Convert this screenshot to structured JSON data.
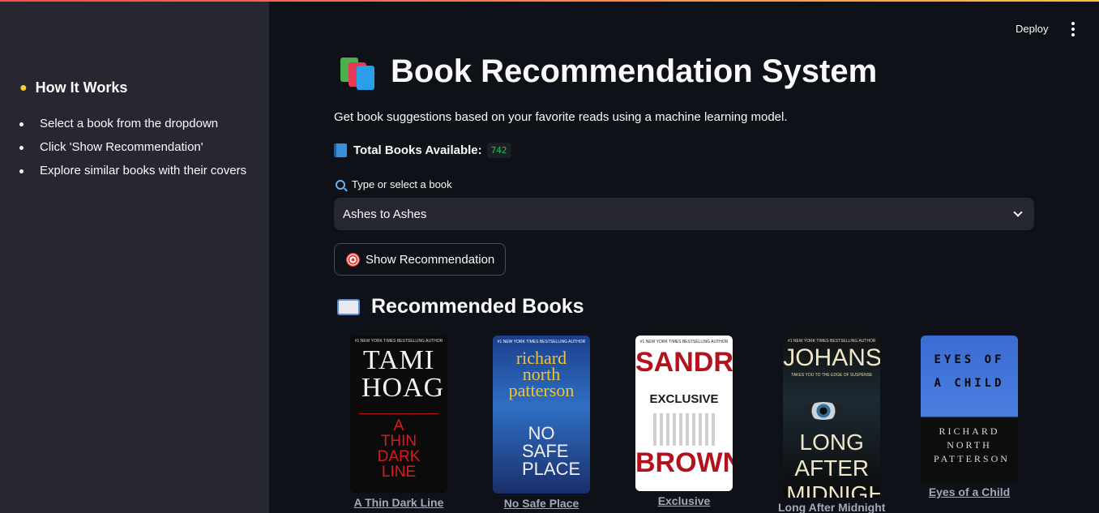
{
  "sidebar": {
    "heading": "How It Works",
    "heading_icon": "lightbulb-icon",
    "items": [
      {
        "label": "Select a book from the dropdown"
      },
      {
        "label": "Click 'Show Recommendation'"
      },
      {
        "label": "Explore similar books with their covers"
      }
    ]
  },
  "header": {
    "deploy_label": "Deploy",
    "menu_icon": "kebab-menu-icon"
  },
  "main": {
    "title": "Book Recommendation System",
    "title_icon": "books-icon",
    "subtitle": "Get book suggestions based on your favorite reads using a machine learning model.",
    "total_label": "Total Books Available:",
    "total_value": "742",
    "select_label": "Type or select a book",
    "select_value": "Ashes to Ashes",
    "button_label": "Show Recommendation",
    "rec_heading": "Recommended Books"
  },
  "books": [
    {
      "title": "A Thin Dark Line",
      "cover": {
        "top": "#1 NEW YORK TIMES BESTSELLING AUTHOR",
        "author": "TAMI HOAG",
        "title": "A THIN DARK LINE"
      }
    },
    {
      "title": "No Safe Place",
      "cover": {
        "top": "#1 NEW YORK TIMES BESTSELLING AUTHOR",
        "author": "richard north patterson",
        "title": "NO SAFE PLACE"
      }
    },
    {
      "title": "Exclusive",
      "cover": {
        "top": "#1 NEW YORK TIMES BESTSELLING AUTHOR",
        "author_first": "SANDRA",
        "title": "EXCLUSIVE",
        "author_last": "BROWN"
      }
    },
    {
      "title": "Long After Midnight",
      "cover": {
        "top": "#1 NEW YORK TIMES BESTSELLING AUTHOR",
        "author": "JOHANSEN",
        "tagline": "TAKES YOU TO THE EDGE OF SUSPENSE",
        "title": "LONG AFTER MIDNIGHT"
      }
    },
    {
      "title": "Eyes of a Child",
      "cover": {
        "title": "EYES OF A CHILD",
        "author": "RICHARD NORTH PATTERSON"
      }
    }
  ],
  "colors": {
    "background": "#0e1117",
    "sidebar": "#262730",
    "accent_start": "#ff4b4b",
    "accent_end": "#ffbd45",
    "badge_text": "#21c354"
  }
}
